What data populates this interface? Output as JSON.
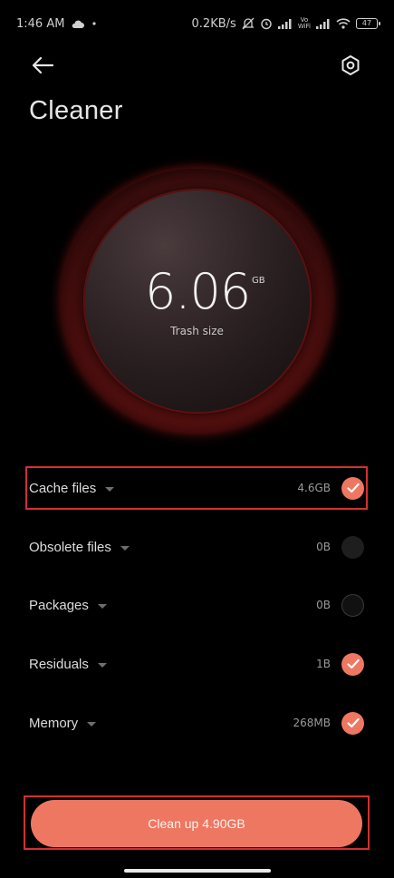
{
  "status_bar": {
    "time": "1:46 AM",
    "net_speed": "0.2KB/s",
    "volte": "Vo",
    "wifi_label": "WiFi",
    "battery": "47",
    "icons": [
      "cloud-icon",
      "dot-icon",
      "mute-icon",
      "alarm-icon",
      "signal-icon",
      "volte-icon",
      "signal-icon",
      "wifi-icon",
      "battery-icon"
    ]
  },
  "header": {
    "title": "Cleaner",
    "back_icon": "back-arrow-icon",
    "settings_icon": "settings-hex-icon"
  },
  "dial": {
    "value": "6.06",
    "unit": "GB",
    "label": "Trash size",
    "accent": "#c92a2a"
  },
  "items": [
    {
      "label": "Cache files",
      "size": "4.6GB",
      "checked": true
    },
    {
      "label": "Obsolete files",
      "size": "0B",
      "checked": false
    },
    {
      "label": "Packages",
      "size": "0B",
      "checked": false
    },
    {
      "label": "Residuals",
      "size": "1B",
      "checked": true
    },
    {
      "label": "Memory",
      "size": "268MB",
      "checked": true
    }
  ],
  "clean_button": {
    "label": "Clean up 4.90GB",
    "color": "#ee7762"
  },
  "colors": {
    "background": "#000000",
    "accent": "#ee7762",
    "highlight": "#d23030"
  }
}
